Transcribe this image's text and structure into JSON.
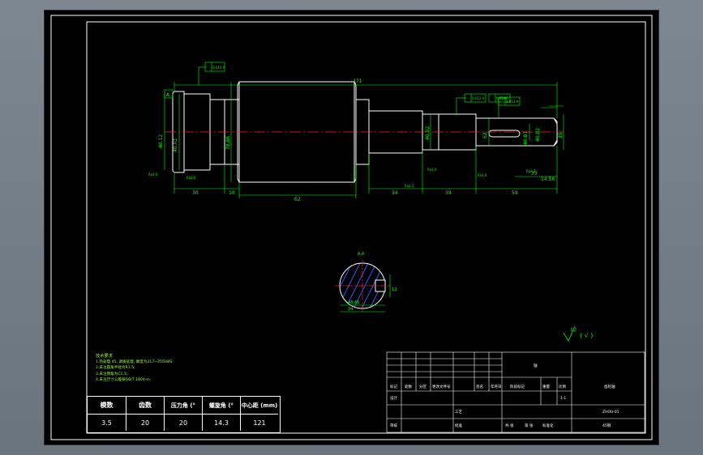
{
  "colors": {
    "background": "#6f7982",
    "canvas": "#000000",
    "frame": "#ffffff",
    "outline": "#ffffff",
    "dimension": "#00ff00",
    "centerline": "#ff2020",
    "hatch": "#3355ff",
    "text_green": "#99ff33"
  },
  "drawing": {
    "dims": {
      "overall": "371",
      "d1": "40.12",
      "d2": "40.02",
      "d3": "78.86",
      "d4": "62",
      "d5": "40.02",
      "d6": "40.01",
      "d7": "40.02",
      "d8": "35",
      "l1": "30",
      "l2": "10",
      "l3": "62",
      "l4": "34",
      "l5": "39",
      "l6": "59",
      "l7": "33",
      "l8": "14.56",
      "key_width": "12",
      "key_depth": "48.66",
      "key_bottom": "34"
    },
    "datum": "A",
    "section_label": "A-A",
    "surface_finish": "3.2",
    "surface_mark": "( √ )",
    "roughness_labels": [
      "Ra1.6",
      "Ra1.6",
      "Ra3.2",
      "Ra1.6",
      "Ra1.6",
      "Ra3.2"
    ],
    "tolerance_frames": [
      "0.012 A",
      "0.012 A",
      "0.02 A",
      "0.012 A"
    ]
  },
  "tech_req": {
    "title": "技术要求",
    "items": [
      "1.热处理 45, 调质处理, 硬度为217~255HBS;",
      "2.未注圆角半径为R1.5;",
      "3.未注倒角为C1.5;",
      "4.未注尺寸公差按GB/T 1804-m."
    ]
  },
  "param_table": {
    "headers": [
      "模数",
      "齿数",
      "压力角 (°",
      "螺旋角 (°",
      "中心距 (mm)"
    ],
    "values": [
      "3.5",
      "20",
      "20",
      "14.3",
      "121"
    ]
  },
  "title_block": {
    "drawing_title": "轴",
    "row_headers": [
      "标记",
      "处数",
      "分区",
      "更改文件号",
      "签名",
      "年月日"
    ],
    "labels": [
      "设计",
      "审核",
      "工艺",
      "批准",
      "阶段标记",
      "重量",
      "比例",
      "共 张",
      "第 张",
      "标准化"
    ],
    "scale": "1:1",
    "unit": "齿轮轴",
    "drawing_no": "ZHOU-01",
    "material": "45钢"
  }
}
